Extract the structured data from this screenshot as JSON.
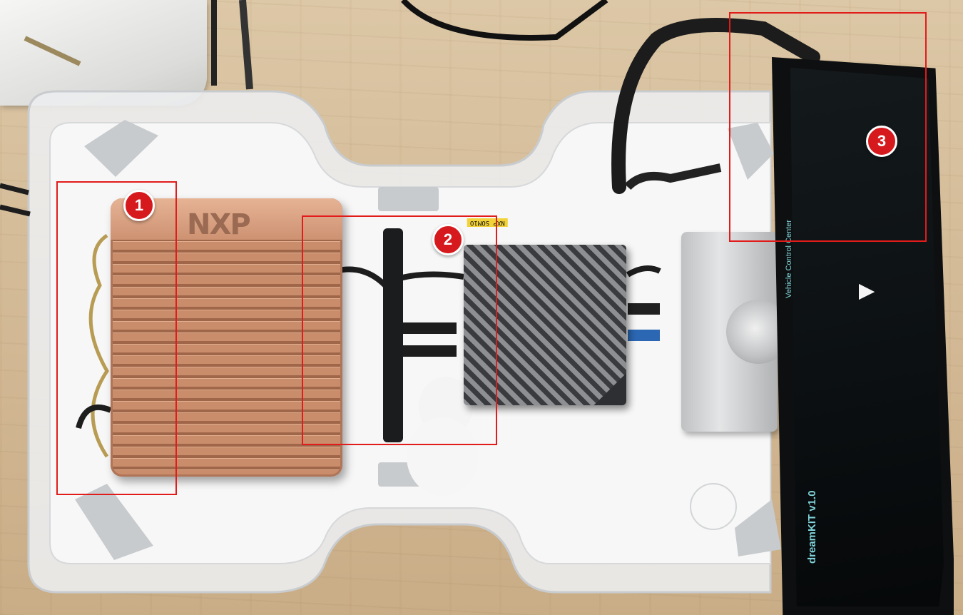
{
  "hardware": {
    "left_module_logo": "NXP",
    "center_module_label": "NXP SOM1O",
    "screen_title": "Vehicle Control Center",
    "screen_brand": "dreamKIT v1.0"
  },
  "callouts": [
    {
      "number": "1",
      "color": "#e21b1b"
    },
    {
      "number": "2",
      "color": "#e21b1b"
    },
    {
      "number": "3",
      "color": "#e21b1b"
    }
  ]
}
